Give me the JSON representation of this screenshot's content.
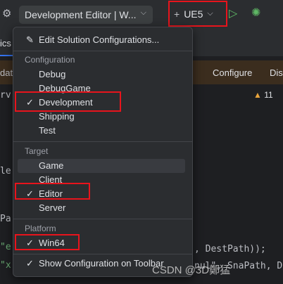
{
  "toolbar": {
    "config_selector": "Development Editor | W...",
    "platform_selector": "UE5",
    "icons": [
      "unreal-engine-icon",
      "chevron-down-icon",
      "add-icon",
      "run-icon",
      "debug-icon"
    ]
  },
  "background": {
    "tab_fragment": "ics",
    "bar_left_fragment": "date",
    "bar_configure": "Configure",
    "bar_dis": "Dis",
    "warning_count": "11",
    "code_fragments": [
      "rv",
      "le",
      "Pa",
      "\"e",
      "\"x"
    ],
    "code_line_destpath": ", DestPath));",
    "code_line_snapath": "nul\", SnaPath, D"
  },
  "popup": {
    "edit_item": "Edit Solution Configurations...",
    "configuration": {
      "header": "Configuration",
      "items": [
        {
          "label": "Debug",
          "checked": false
        },
        {
          "label": "DebugGame",
          "checked": false
        },
        {
          "label": "Development",
          "checked": true
        },
        {
          "label": "Shipping",
          "checked": false
        },
        {
          "label": "Test",
          "checked": false
        }
      ]
    },
    "target": {
      "header": "Target",
      "items": [
        {
          "label": "Game",
          "checked": false
        },
        {
          "label": "Client",
          "checked": false
        },
        {
          "label": "Editor",
          "checked": true
        },
        {
          "label": "Server",
          "checked": false
        }
      ]
    },
    "platform": {
      "header": "Platform",
      "items": [
        {
          "label": "Win64",
          "checked": true
        }
      ]
    },
    "show_toolbar_item": {
      "label": "Show Configuration on Toolbar",
      "checked": true
    },
    "check_glyph": "✓"
  },
  "watermark": "CSDN @3D鄭猛",
  "colors": {
    "highlight_box": "#e8141c",
    "popup_bg": "#2b2d30",
    "run_green": "#5fb865"
  }
}
